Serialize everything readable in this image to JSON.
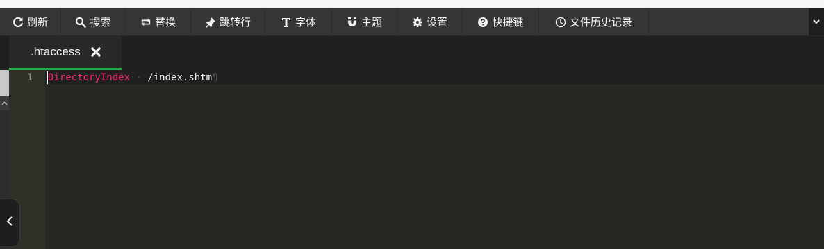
{
  "toolbar": {
    "buttons": [
      {
        "label": "刷新",
        "icon": "refresh-icon"
      },
      {
        "label": "搜索",
        "icon": "search-icon"
      },
      {
        "label": "替换",
        "icon": "replace-icon"
      },
      {
        "label": "跳转行",
        "icon": "pin-icon"
      },
      {
        "label": "字体",
        "icon": "text-cursor-icon"
      },
      {
        "label": "主题",
        "icon": "magnet-icon"
      },
      {
        "label": "设置",
        "icon": "gear-icon"
      },
      {
        "label": "快捷键",
        "icon": "question-circle-icon"
      },
      {
        "label": "文件历史记录",
        "icon": "clock-icon"
      }
    ],
    "more_icon": "chevron-down-icon"
  },
  "tabs": [
    {
      "name": ".htaccess",
      "active": true,
      "close_icon": "close-icon"
    }
  ],
  "editor": {
    "lines": [
      {
        "number": "1",
        "keyword": "DirectoryIndex",
        "whitespace_marks": "··",
        "text": "/index.shtm",
        "eol_mark": "¶"
      }
    ]
  },
  "sidebar": {
    "collapse_icon": "chevron-left-icon"
  },
  "colors": {
    "toolbar_bg": "#353535",
    "editor_bg": "#272822",
    "gutter_bg": "#2f3129",
    "tab_active_underline": "#2ea94b",
    "keyword": "#f92672"
  }
}
